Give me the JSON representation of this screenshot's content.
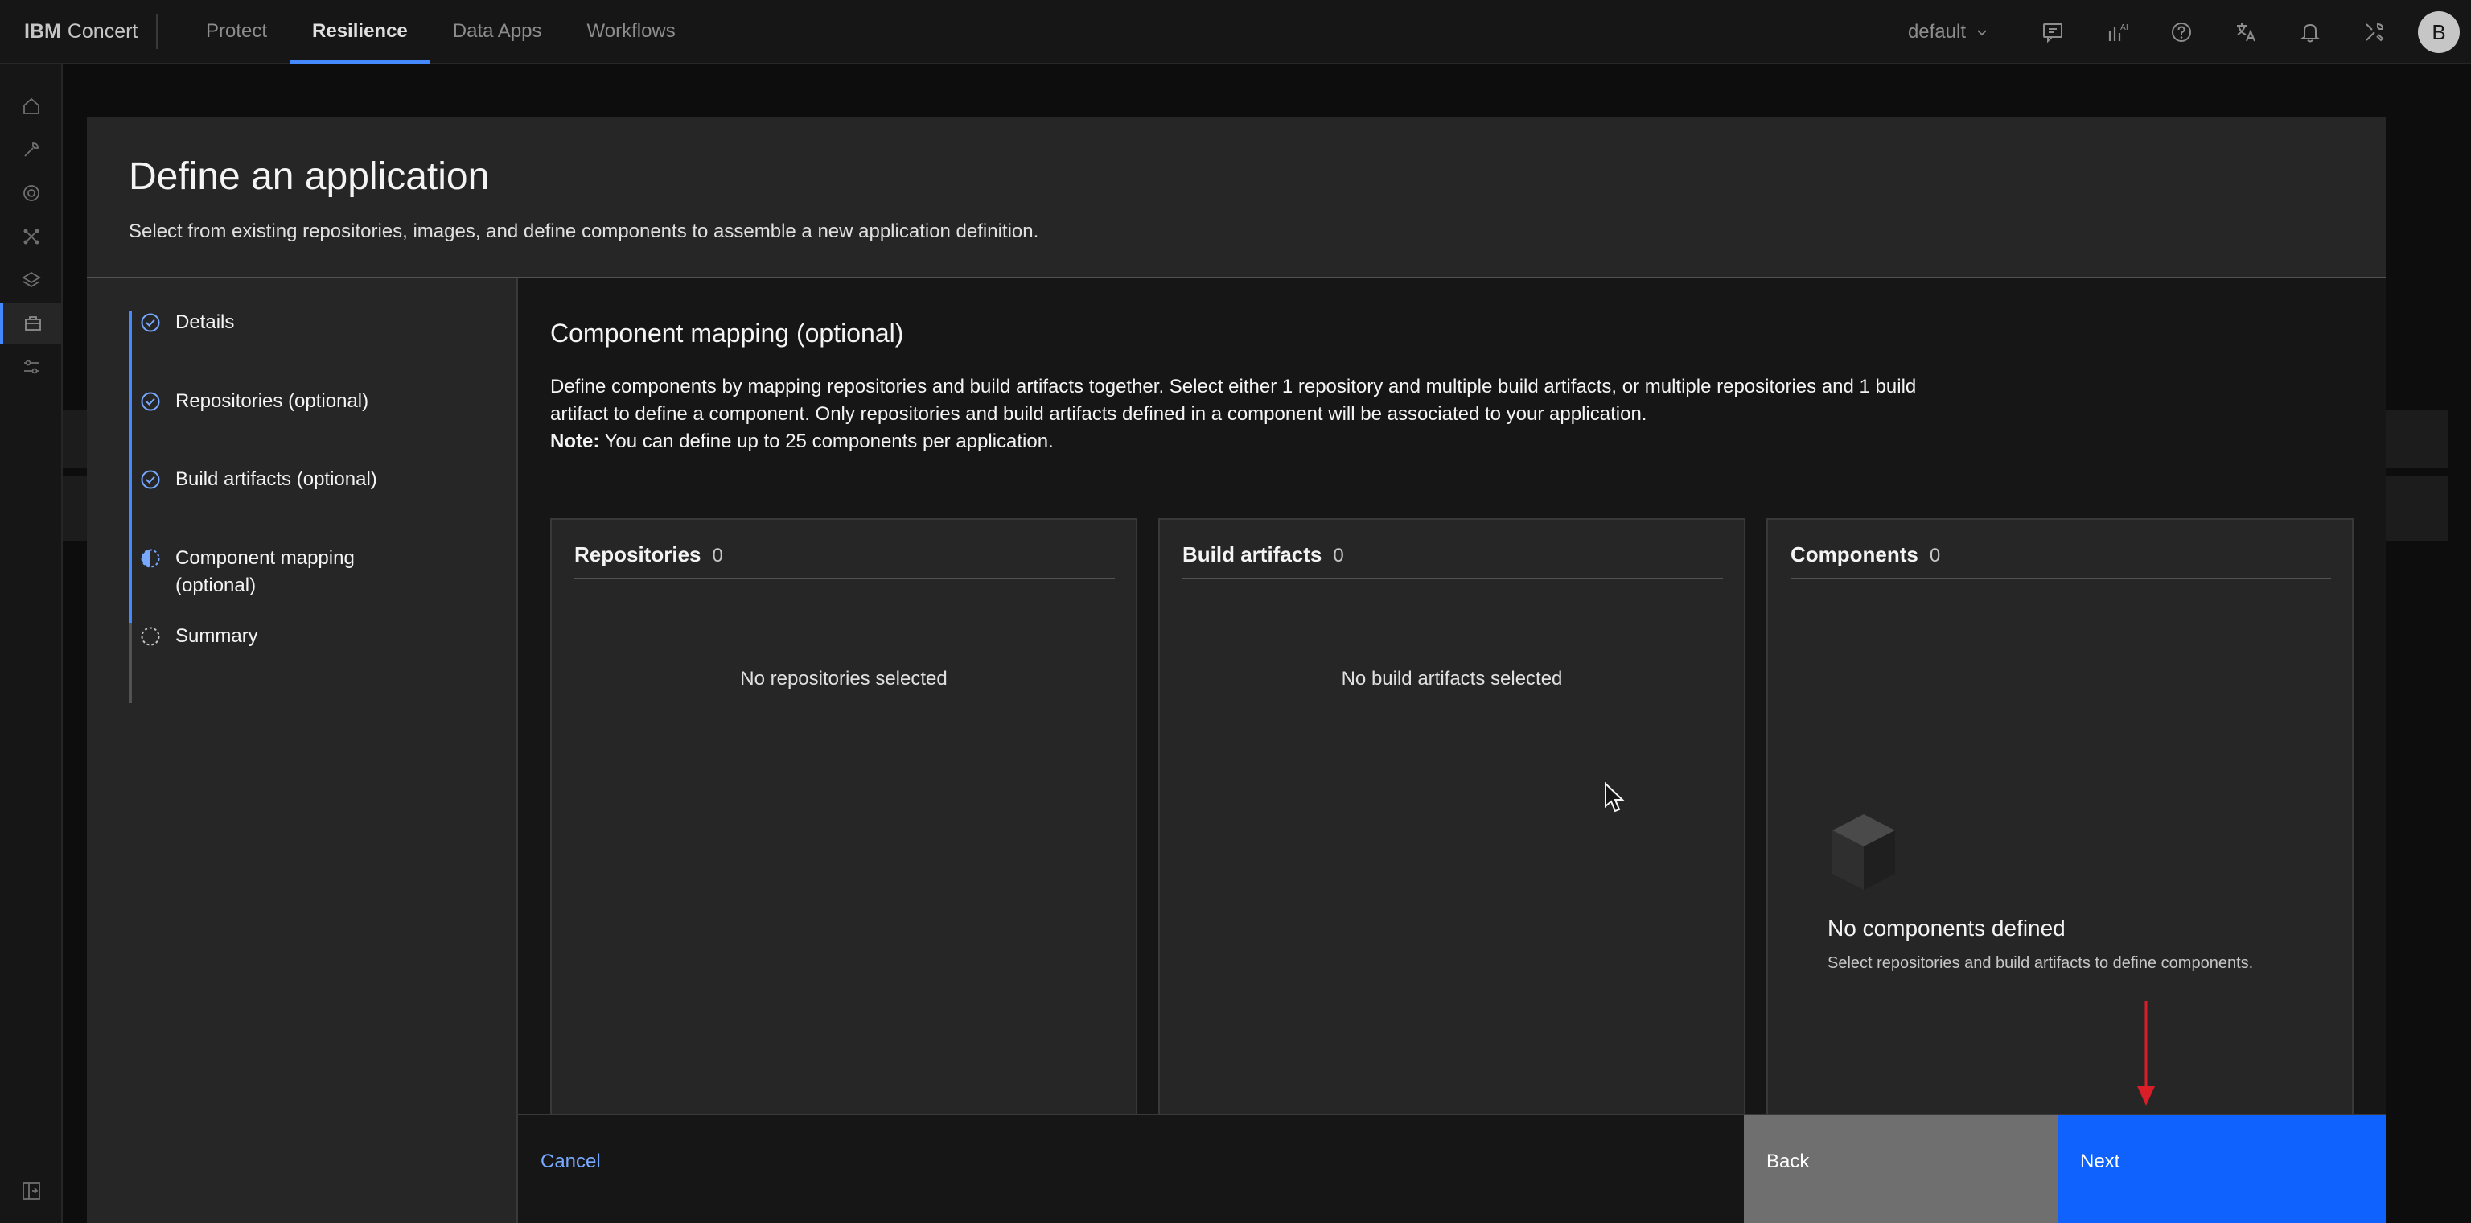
{
  "header": {
    "brand_bold": "IBM",
    "brand_name": "Concert",
    "tabs": [
      {
        "label": "Protect",
        "active": false
      },
      {
        "label": "Resilience",
        "active": true
      },
      {
        "label": "Data Apps",
        "active": false
      },
      {
        "label": "Workflows",
        "active": false
      }
    ],
    "tenant": "default",
    "avatar_initial": "B",
    "icons": [
      "feedback-icon",
      "ai-icon",
      "help-icon",
      "translate-icon",
      "notification-icon",
      "tools-icon"
    ]
  },
  "left_rail": {
    "icons": [
      "home-icon",
      "wrench-icon",
      "target-icon",
      "network-icon",
      "layers-icon",
      "application-icon",
      "settings-sliders-icon",
      "collapse-panel-icon"
    ]
  },
  "modal": {
    "title": "Define an application",
    "subtitle": "Select from existing repositories, images, and define components to assemble a new application definition.",
    "steps": [
      {
        "label": "Details",
        "state": "complete"
      },
      {
        "label": "Repositories (optional)",
        "state": "complete"
      },
      {
        "label": "Build artifacts (optional)",
        "state": "complete"
      },
      {
        "label": "Component mapping",
        "label2": "(optional)",
        "state": "current"
      },
      {
        "label": "Summary",
        "state": "incomplete"
      }
    ],
    "section_title": "Component mapping (optional)",
    "description": "Define components by mapping repositories and build artifacts together. Select either 1 repository and multiple build artifacts, or multiple repositories and 1 build artifact to define a component. Only repositories and build artifacts defined in a component will be associated to your application.",
    "note_label": "Note:",
    "note_text": " You can define up to 25 components per application.",
    "tiles": {
      "repositories": {
        "title": "Repositories",
        "count": "0",
        "empty": "No repositories selected"
      },
      "build_artifacts": {
        "title": "Build artifacts",
        "count": "0",
        "empty": "No build artifacts selected"
      },
      "components": {
        "title": "Components",
        "count": "0",
        "empty_title": "No components defined",
        "empty_desc": "Select repositories and build artifacts to define components."
      }
    },
    "footer": {
      "cancel": "Cancel",
      "back": "Back",
      "next": "Next"
    }
  },
  "colors": {
    "accent": "#0f62fe",
    "link": "#78a9ff",
    "annotation_arrow": "#da1e28"
  }
}
